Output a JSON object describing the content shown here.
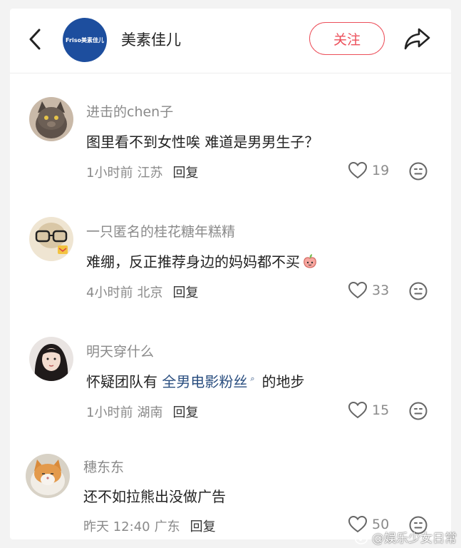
{
  "header": {
    "brand_name": "美素佳儿",
    "logo_text": "Friso美素佳儿",
    "follow_label": "关注",
    "accent_color": "#ec4f5a"
  },
  "comments": [
    {
      "username": "进击的chen子",
      "text": "图里看不到女性唉 难道是男男生子？",
      "time": "1小时前",
      "location": "江苏",
      "reply_label": "回复",
      "likes": "19",
      "avatar": "cat-avatar"
    },
    {
      "username": "一只匿名的桂花糖年糕精",
      "text": "难绷，反正推荐身边的妈妈都不买",
      "emoji": "peach-emoji",
      "time": "4小时前",
      "location": "北京",
      "reply_label": "回复",
      "likes": "33",
      "avatar": "glasses-avatar"
    },
    {
      "username": "明天穿什么",
      "text_before": "怀疑团队有",
      "link_text": "全男电影粉丝",
      "text_after": "的地步",
      "time": "1小时前",
      "location": "湖南",
      "reply_label": "回复",
      "likes": "15",
      "avatar": "girl-avatar"
    },
    {
      "username": "穗东东",
      "text": "还不如拉熊出没做广告",
      "time": "昨天 12:40",
      "location": "广东",
      "reply_label": "回复",
      "likes": "50",
      "avatar": "orange-cat-avatar"
    }
  ],
  "watermark": "@娱乐少女日常"
}
